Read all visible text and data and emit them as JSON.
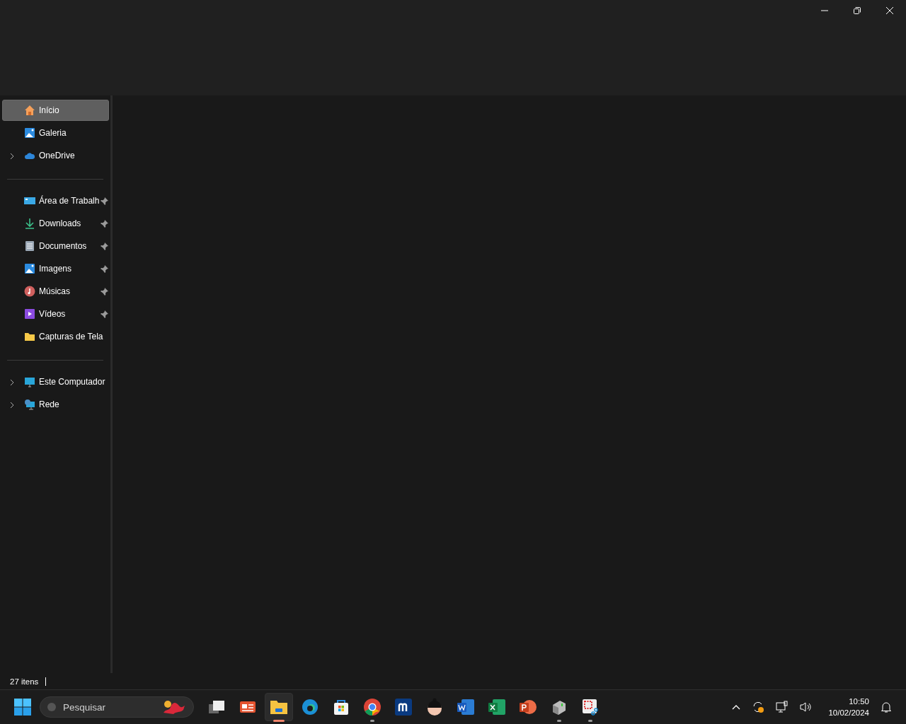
{
  "window": {
    "controls": [
      {
        "kind": "minimize"
      },
      {
        "kind": "restore"
      },
      {
        "kind": "close"
      }
    ]
  },
  "sidebar": {
    "groups": [
      {
        "items": [
          {
            "label": "Início",
            "kind": "home",
            "selected": true,
            "expandable": false,
            "pinned": false
          },
          {
            "label": "Galeria",
            "kind": "gallery",
            "selected": false,
            "expandable": false,
            "pinned": false
          },
          {
            "label": "OneDrive",
            "kind": "cloud",
            "selected": false,
            "expandable": true,
            "pinned": false
          }
        ]
      },
      {
        "items": [
          {
            "label": "Área de Trabalh",
            "kind": "desktop",
            "selected": false,
            "expandable": false,
            "pinned": true
          },
          {
            "label": "Downloads",
            "kind": "download",
            "selected": false,
            "expandable": false,
            "pinned": true
          },
          {
            "label": "Documentos",
            "kind": "document",
            "selected": false,
            "expandable": false,
            "pinned": true
          },
          {
            "label": "Imagens",
            "kind": "gallery",
            "selected": false,
            "expandable": false,
            "pinned": true
          },
          {
            "label": "Músicas",
            "kind": "music",
            "selected": false,
            "expandable": false,
            "pinned": true
          },
          {
            "label": "Vídeos",
            "kind": "video",
            "selected": false,
            "expandable": false,
            "pinned": true
          },
          {
            "label": "Capturas de Tela",
            "kind": "folder",
            "selected": false,
            "expandable": false,
            "pinned": false
          }
        ]
      },
      {
        "items": [
          {
            "label": "Este Computador",
            "kind": "monitor",
            "selected": false,
            "expandable": true,
            "pinned": false
          },
          {
            "label": "Rede",
            "kind": "network",
            "selected": false,
            "expandable": true,
            "pinned": false
          }
        ]
      }
    ]
  },
  "status_bar": {
    "count": "27 itens"
  },
  "taskbar": {
    "search": {
      "placeholder": "Pesquisar"
    },
    "apps": [
      {
        "kind": "taskview",
        "running": false,
        "active": false
      },
      {
        "kind": "widgets",
        "running": false,
        "active": false
      },
      {
        "kind": "explorer",
        "running": true,
        "active": true
      },
      {
        "kind": "edge",
        "running": false,
        "active": false
      },
      {
        "kind": "store",
        "running": false,
        "active": false
      },
      {
        "kind": "chrome",
        "running": true,
        "active": false
      },
      {
        "kind": "mapp",
        "running": false,
        "active": false
      },
      {
        "kind": "face",
        "running": false,
        "active": false
      },
      {
        "kind": "word",
        "running": false,
        "active": false
      },
      {
        "kind": "excel",
        "running": false,
        "active": false
      },
      {
        "kind": "powerpoint",
        "running": false,
        "active": false
      },
      {
        "kind": "drive",
        "running": true,
        "active": false
      },
      {
        "kind": "snip",
        "running": true,
        "active": false
      }
    ],
    "tray": {
      "time": "10:50",
      "date": "10/02/2024"
    }
  }
}
